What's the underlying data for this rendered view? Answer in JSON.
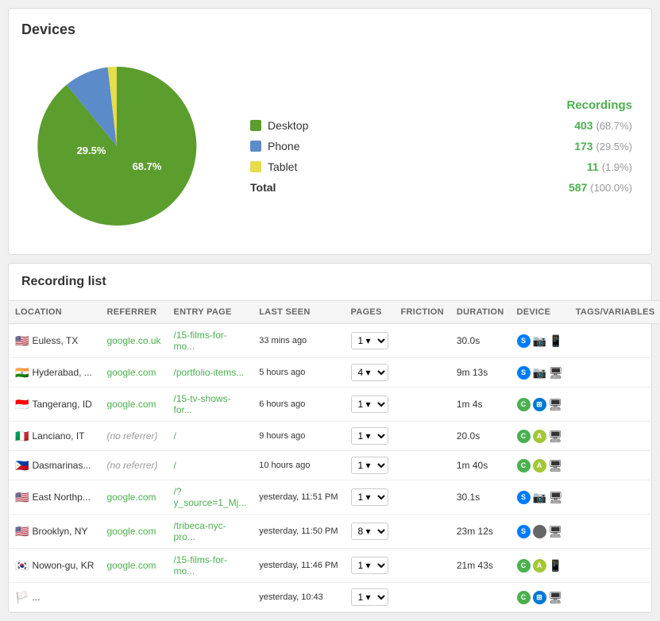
{
  "devices": {
    "title": "Devices",
    "legend_header": "Recordings",
    "items": [
      {
        "label": "Desktop",
        "color": "#5B9E2E",
        "count": "403",
        "pct": "(68.7%)",
        "slice_pct": 68.7
      },
      {
        "label": "Phone",
        "color": "#5B8CC9",
        "count": "173",
        "pct": "(29.5%)",
        "slice_pct": 29.5
      },
      {
        "label": "Tablet",
        "color": "#E8DC48",
        "count": "11",
        "pct": "(1.9%)",
        "slice_pct": 1.8
      }
    ],
    "total_label": "Total",
    "total_count": "587",
    "total_pct": "(100.0%)",
    "desktop_pct_label": "68.7%",
    "phone_pct_label": "29.5%"
  },
  "recording_list": {
    "title": "Recording list",
    "columns": [
      "LOCATION",
      "REFERRER",
      "ENTRY PAGE",
      "LAST SEEN",
      "PAGES",
      "FRICTION",
      "DURATION",
      "DEVICE",
      "TAGS/VARIABLES"
    ],
    "rows": [
      {
        "flag": "🇺🇸",
        "location": "Euless, TX",
        "referrer": "google.co.uk",
        "referrer_type": "link",
        "entry_page": "/15-films-for-mo...",
        "last_seen": "33 mins ago",
        "pages": "1",
        "friction": "",
        "duration": "30.0s",
        "icons": [
          "safari",
          "camera",
          "mobile"
        ]
      },
      {
        "flag": "🇮🇳",
        "location": "Hyderabad, ...",
        "referrer": "google.com",
        "referrer_type": "link",
        "entry_page": "/portfolio-items...",
        "last_seen": "5 hours ago",
        "pages": "4",
        "friction": "",
        "duration": "9m 13s",
        "icons": [
          "safari",
          "camera",
          "desktop"
        ]
      },
      {
        "flag": "🇮🇩",
        "location": "Tangerang, ID",
        "referrer": "google.com",
        "referrer_type": "link",
        "entry_page": "/15-tv-shows-for...",
        "last_seen": "6 hours ago",
        "pages": "1",
        "friction": "",
        "duration": "1m 4s",
        "icons": [
          "chrome",
          "win",
          "desktop"
        ]
      },
      {
        "flag": "🇮🇹",
        "location": "Lanciano, IT",
        "referrer": "(no referrer)",
        "referrer_type": "none",
        "entry_page": "/",
        "last_seen": "9 hours ago",
        "pages": "1",
        "friction": "",
        "duration": "20.0s",
        "icons": [
          "chrome",
          "android",
          "desktop"
        ]
      },
      {
        "flag": "🇵🇭",
        "location": "Dasmarinas...",
        "referrer": "(no referrer)",
        "referrer_type": "none",
        "entry_page": "/",
        "last_seen": "10 hours ago",
        "pages": "1",
        "friction": "",
        "duration": "1m 40s",
        "icons": [
          "chrome",
          "android",
          "desktop"
        ]
      },
      {
        "flag": "🇺🇸",
        "location": "East Northp...",
        "referrer": "google.com",
        "referrer_type": "link",
        "entry_page": "/?y_source=1_Mj...",
        "last_seen": "yesterday, 11:51 PM",
        "pages": "1",
        "friction": "",
        "duration": "30.1s",
        "icons": [
          "safari",
          "camera",
          "desktop"
        ]
      },
      {
        "flag": "🇺🇸",
        "location": "Brooklyn, NY",
        "referrer": "google.com",
        "referrer_type": "link",
        "entry_page": "/tribeca-nyc-pro...",
        "last_seen": "yesterday, 11:50 PM",
        "pages": "8",
        "friction": "",
        "duration": "23m 12s",
        "icons": [
          "safari",
          "mac",
          "desktop"
        ]
      },
      {
        "flag": "🇰🇷",
        "location": "Nowon-gu, KR",
        "referrer": "google.com",
        "referrer_type": "link",
        "entry_page": "/15-films-for-mo...",
        "last_seen": "yesterday, 11:46 PM",
        "pages": "1",
        "friction": "",
        "duration": "21m 43s",
        "icons": [
          "chrome",
          "android",
          "mobile"
        ]
      },
      {
        "flag": "🏳️",
        "location": "...",
        "referrer": "",
        "referrer_type": "link",
        "entry_page": "",
        "last_seen": "yesterday, 10:43",
        "pages": "1",
        "friction": "",
        "duration": "",
        "icons": [
          "chrome",
          "win",
          "desktop"
        ]
      }
    ]
  }
}
